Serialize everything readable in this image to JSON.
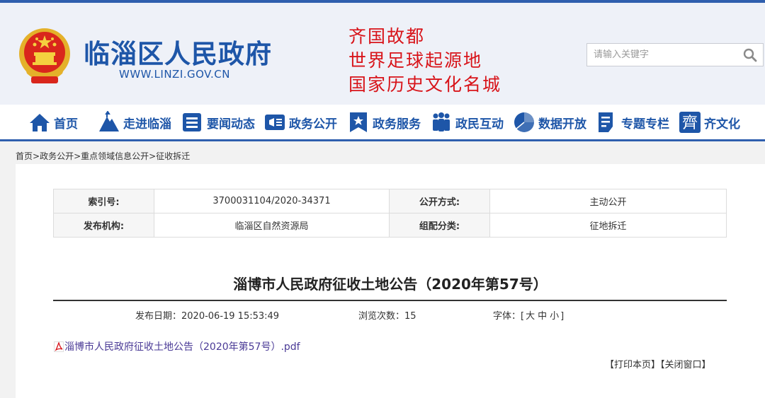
{
  "header": {
    "site_title": "临淄区人民政府",
    "site_url": "WWW.LINZI.GOV.CN",
    "slogans": [
      "齐国故都",
      "世界足球起源地",
      "国家历史文化名城"
    ],
    "search_placeholder": "请输入关键字"
  },
  "nav": {
    "items": [
      {
        "label": "首页",
        "icon": "home-icon"
      },
      {
        "label": "走进临淄",
        "icon": "mountain-icon"
      },
      {
        "label": "要闻动态",
        "icon": "news-icon"
      },
      {
        "label": "政务公开",
        "icon": "announcement-icon"
      },
      {
        "label": "政务服务",
        "icon": "star-bookmark-icon"
      },
      {
        "label": "政民互动",
        "icon": "people-icon"
      },
      {
        "label": "数据开放",
        "icon": "pie-chart-icon"
      },
      {
        "label": "专题专栏",
        "icon": "document-icon"
      },
      {
        "label": "齐文化",
        "icon": "qi-character-icon"
      }
    ]
  },
  "breadcrumb": {
    "items": [
      "首页",
      "政务公开",
      "重点领域信息公开",
      "征收拆迁"
    ],
    "separator": ">"
  },
  "meta": {
    "rows": [
      [
        {
          "key": "索引号:",
          "value": "3700031104/2020-34371"
        },
        {
          "key": "公开方式:",
          "value": "主动公开"
        }
      ],
      [
        {
          "key": "发布机构:",
          "value": "临淄区自然资源局"
        },
        {
          "key": "组配分类:",
          "value": "征地拆迁"
        }
      ]
    ]
  },
  "article": {
    "title": "淄博市人民政府征收土地公告（2020年第57号）",
    "publish_date": "发布日期：2020-06-19 15:53:49",
    "views": "浏览次数：15",
    "font_label": "字体：[",
    "font_sizes": [
      "大",
      "中",
      "小"
    ],
    "font_close": "]",
    "attachment": "淄博市人民政府征收土地公告（2020年第57号）.pdf"
  },
  "actions": {
    "print": "【打印本页】",
    "close": "【关闭窗口】"
  },
  "colors": {
    "brand_blue": "#1e56a8",
    "slogan_red": "#d8141a",
    "link_purple": "#4a3a96"
  }
}
